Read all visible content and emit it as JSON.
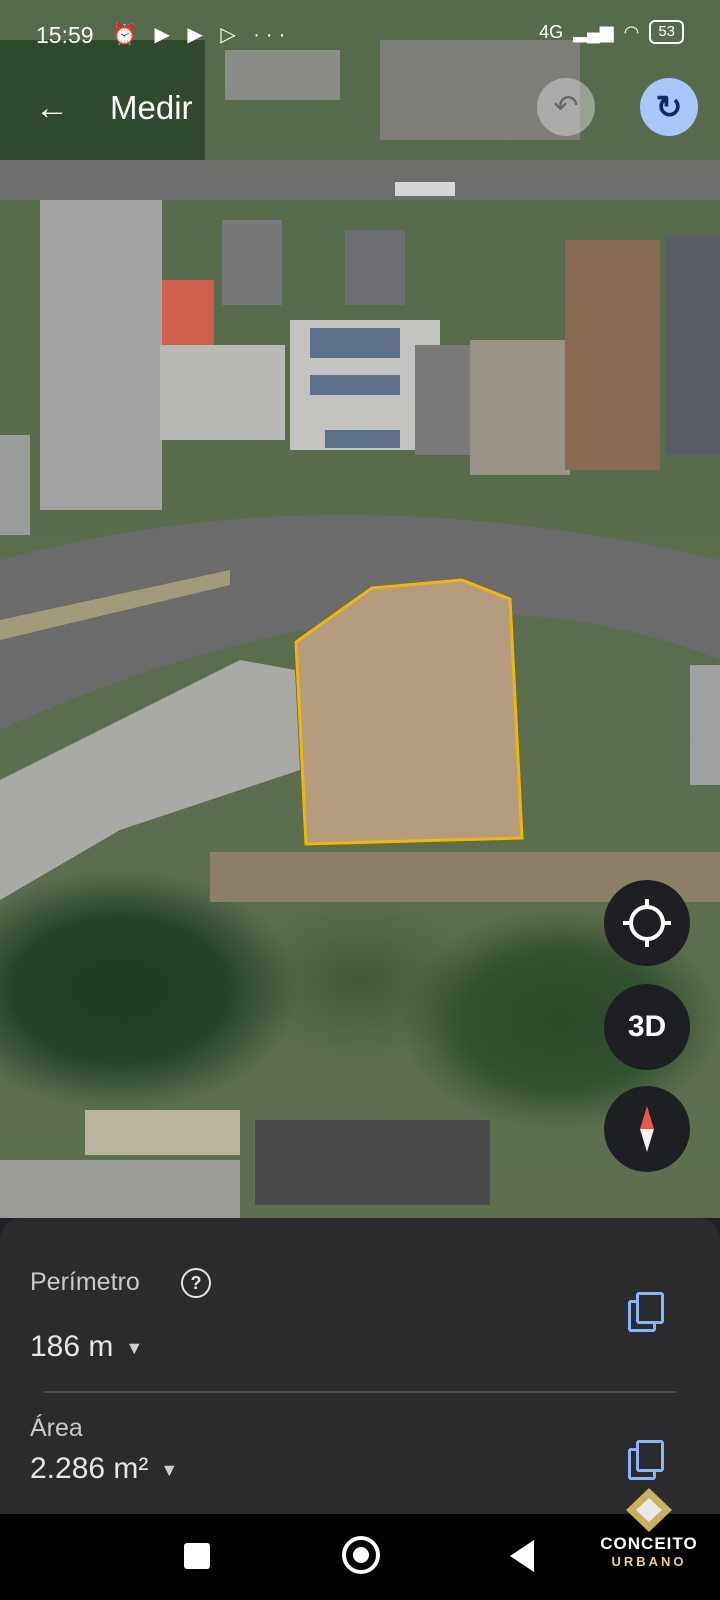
{
  "status_bar": {
    "time": "15:59",
    "notification_icons": "⏰ ▶ ▶ ▷ ···",
    "network": "4G",
    "battery": "53"
  },
  "header": {
    "title": "Medir"
  },
  "measurement": {
    "perimeter_label": "Perímetro",
    "perimeter_value": "186 m",
    "area_label": "Área",
    "area_value": "2.286 m²"
  },
  "map_controls": {
    "three_d_label": "3D"
  },
  "branding": {
    "name": "CONCEITO",
    "sub": "URBANO"
  },
  "colors": {
    "measure_outline": "#f2b705",
    "accent": "#8ab4f8"
  }
}
